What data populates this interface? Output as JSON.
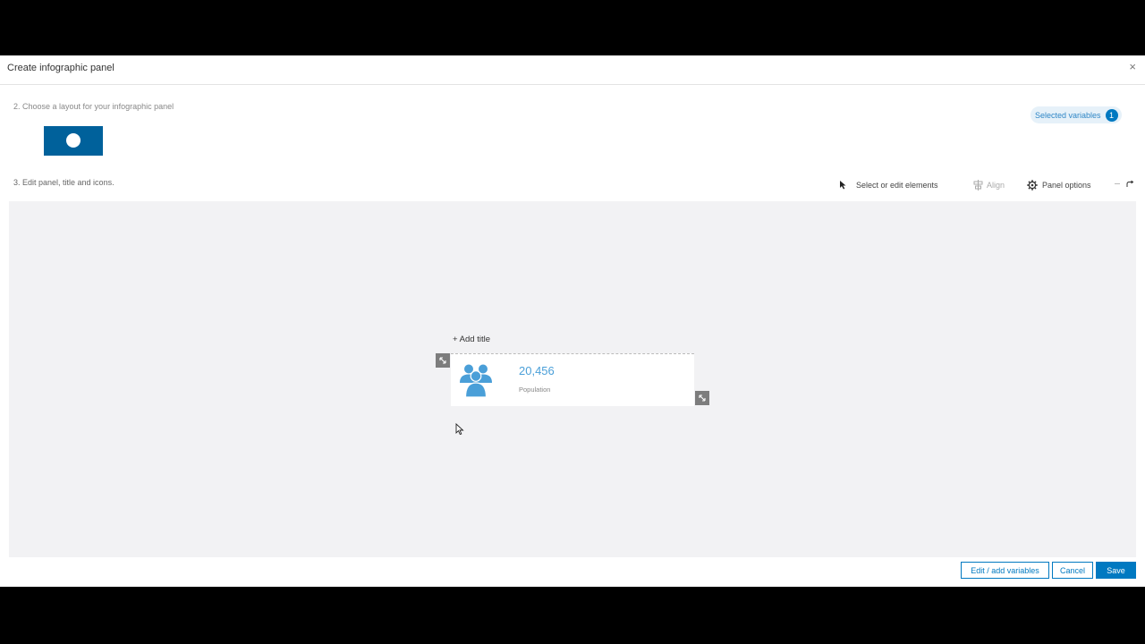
{
  "dialog": {
    "title": "Create infographic panel",
    "close_glyph": "×"
  },
  "step2": {
    "label": "2.  Choose a layout for your infographic panel"
  },
  "selected_variables": {
    "label": "Selected variables",
    "count": "1"
  },
  "step3": {
    "label": "3.  Edit panel, title and icons."
  },
  "toolbar": {
    "select_label": "Select or edit elements",
    "align_label": "Align",
    "panel_options_label": "Panel options"
  },
  "canvas": {
    "add_title": "+ Add title",
    "card": {
      "icon": "people-icon",
      "value": "20,456",
      "label": "Population"
    }
  },
  "footer": {
    "edit_variables": "Edit / add variables",
    "cancel": "Cancel",
    "save": "Save"
  },
  "colors": {
    "accent": "#0079c1",
    "layout_thumb": "#00619b",
    "icon": "#4a9fd8"
  }
}
